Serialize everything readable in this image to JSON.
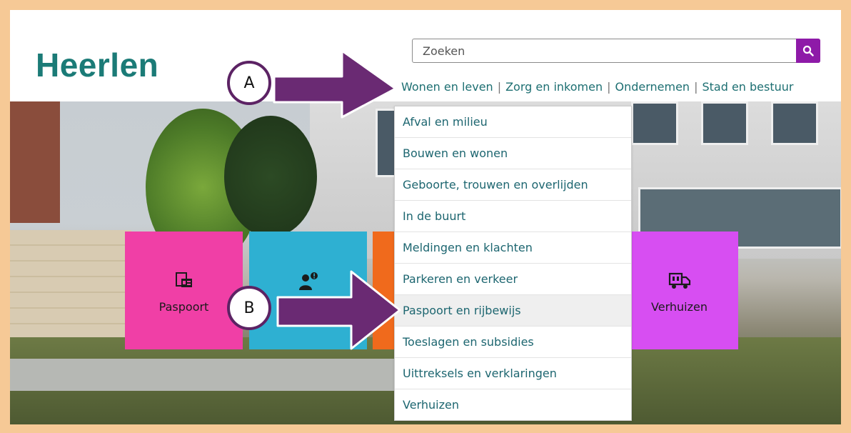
{
  "header": {
    "logo": "Heerlen",
    "search_placeholder": "Zoeken",
    "nav": [
      "Wonen en leven",
      "Zorg en inkomen",
      "Ondernemen",
      "Stad en bestuur"
    ],
    "nav_separator": "|"
  },
  "dropdown": {
    "items": [
      "Afval en milieu",
      "Bouwen en wonen",
      "Geboorte, trouwen en overlijden",
      "In de buurt",
      "Meldingen en klachten",
      "Parkeren en verkeer",
      "Paspoort en rijbewijs",
      "Toeslagen en subsidies",
      "Uittreksels en verklaringen",
      "Verhuizen"
    ],
    "highlighted_index": 6
  },
  "tiles": [
    {
      "label": "Paspoort",
      "icon": "passport-icon",
      "color": "#f03fa6"
    },
    {
      "label": "",
      "icon": "person-alert-icon",
      "color": "#2eb0d2"
    },
    {
      "label": "",
      "icon": "",
      "color": "#f06a1c"
    },
    {
      "label": "Verhuizen",
      "icon": "moving-truck-icon",
      "color": "#d74ef2"
    }
  ],
  "annotations": {
    "a": "A",
    "b": "B"
  },
  "colors": {
    "brand_teal": "#1b7b77",
    "accent_purple": "#8e1aa8",
    "arrow_purple": "#5c2364",
    "frame": "#f6c996"
  }
}
